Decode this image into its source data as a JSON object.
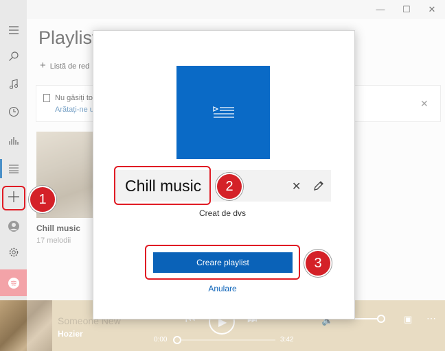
{
  "window": {
    "minimize_glyph": "—",
    "maximize_glyph": "☐",
    "close_glyph": "✕"
  },
  "header": {
    "title": "Playlist"
  },
  "toolbar": {
    "new_playlist_label": "Listă de red"
  },
  "notice": {
    "text": "Nu găsiți to",
    "link": "Arătați-ne u"
  },
  "tile": {
    "name": "Chill music",
    "sub": "17 melodii"
  },
  "player": {
    "song": "Someone New",
    "artist": "Hozier",
    "elapsed": "0:00",
    "duration": "3:42",
    "progress": 0
  },
  "dialog": {
    "playlist_name": "Chill music",
    "creator": "Creat de dvs",
    "create_label": "Creare playlist",
    "cancel_label": "Anulare"
  },
  "badges": {
    "one": "1",
    "two": "2",
    "three": "3"
  },
  "colors": {
    "accent": "#0a62b8",
    "cover": "#0a6ac6",
    "highlight": "#e01b24",
    "player_bg": "#dcc9a3"
  },
  "icons": [
    "hamburger-icon",
    "search-icon",
    "music-note-icon",
    "clock-icon",
    "equalizer-icon",
    "playlist-icon",
    "plus-icon",
    "user-icon",
    "gear-icon",
    "spotify-icon",
    "playlist-cover-icon",
    "clear-icon",
    "pencil-icon"
  ]
}
